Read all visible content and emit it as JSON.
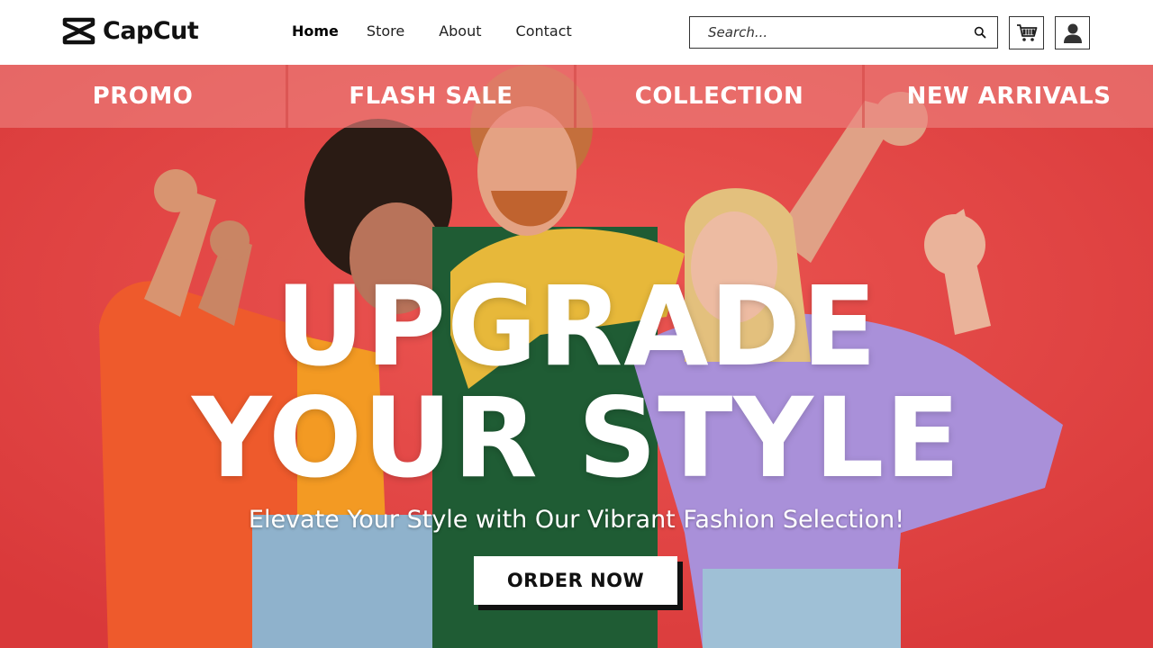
{
  "brand": {
    "name": "CapCut",
    "icon": "capcut-logo-icon"
  },
  "nav": {
    "items": [
      {
        "label": "Home",
        "active": true
      },
      {
        "label": "Store",
        "active": false
      },
      {
        "label": "About",
        "active": false
      },
      {
        "label": "Contact",
        "active": false
      }
    ]
  },
  "search": {
    "placeholder": "Search...",
    "value": "",
    "icon": "search-icon"
  },
  "header_icons": {
    "cart": "cart-icon",
    "account": "user-icon"
  },
  "categories": [
    {
      "label": "PROMO"
    },
    {
      "label": "FLASH SALE"
    },
    {
      "label": "COLLECTION"
    },
    {
      "label": "NEW ARRIVALS"
    }
  ],
  "hero": {
    "headline_line1": "UPGRADE",
    "headline_line2": "YOUR STYLE",
    "tagline": "Elevate Your Style with Our Vibrant Fashion Selection!",
    "cta_label": "ORDER NOW"
  },
  "colors": {
    "hero_background": "#e2413f",
    "category_bar": "#ee8280",
    "text_on_hero": "#ffffff",
    "cta_background": "#ffffff",
    "cta_shadow": "#111111"
  }
}
